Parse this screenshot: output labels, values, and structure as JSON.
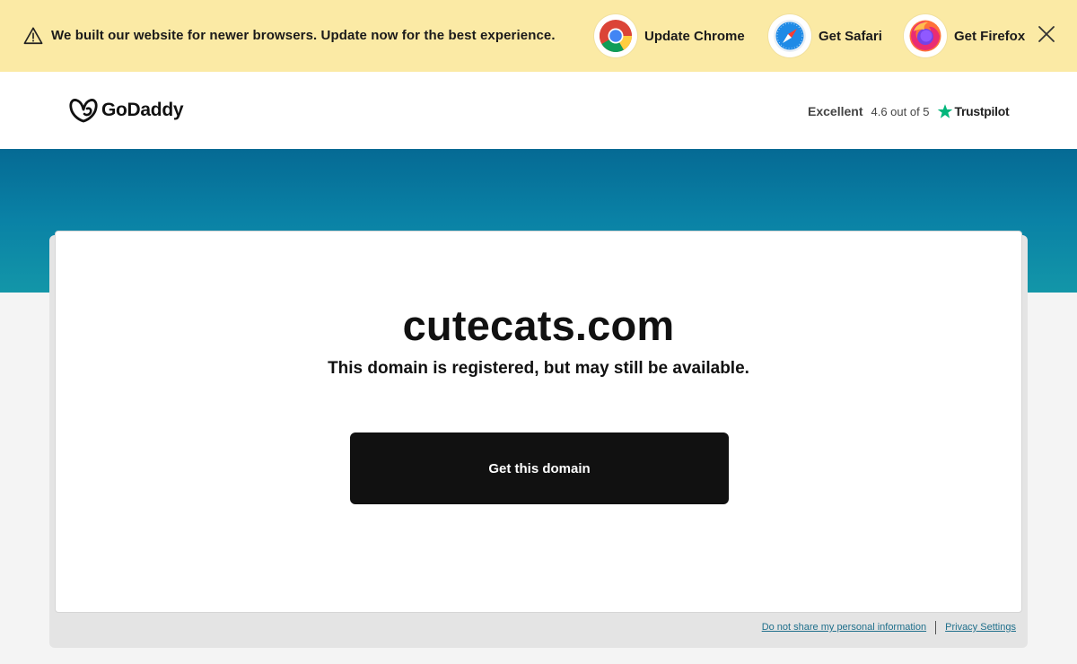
{
  "banner": {
    "message": "We built our website for newer browsers. Update now for the best experience.",
    "chrome_label": "Update Chrome",
    "safari_label": "Get Safari",
    "firefox_label": "Get Firefox",
    "close_icon": "close-icon",
    "warning_icon": "warning-triangle-icon",
    "background_color": "#fbeaa5"
  },
  "header": {
    "logo_text": "GoDaddy",
    "rating_label": "Excellent",
    "rating_score": "4.6 out of 5",
    "rating_brand": "Trustpilot",
    "star_color": "#00b67a"
  },
  "main": {
    "domain": "cutecats.com",
    "subtitle": "This domain is registered, but may still be available.",
    "cta_label": "Get this domain"
  },
  "footer": {
    "do_not_share": "Do not share my personal information",
    "privacy": "Privacy Settings"
  }
}
